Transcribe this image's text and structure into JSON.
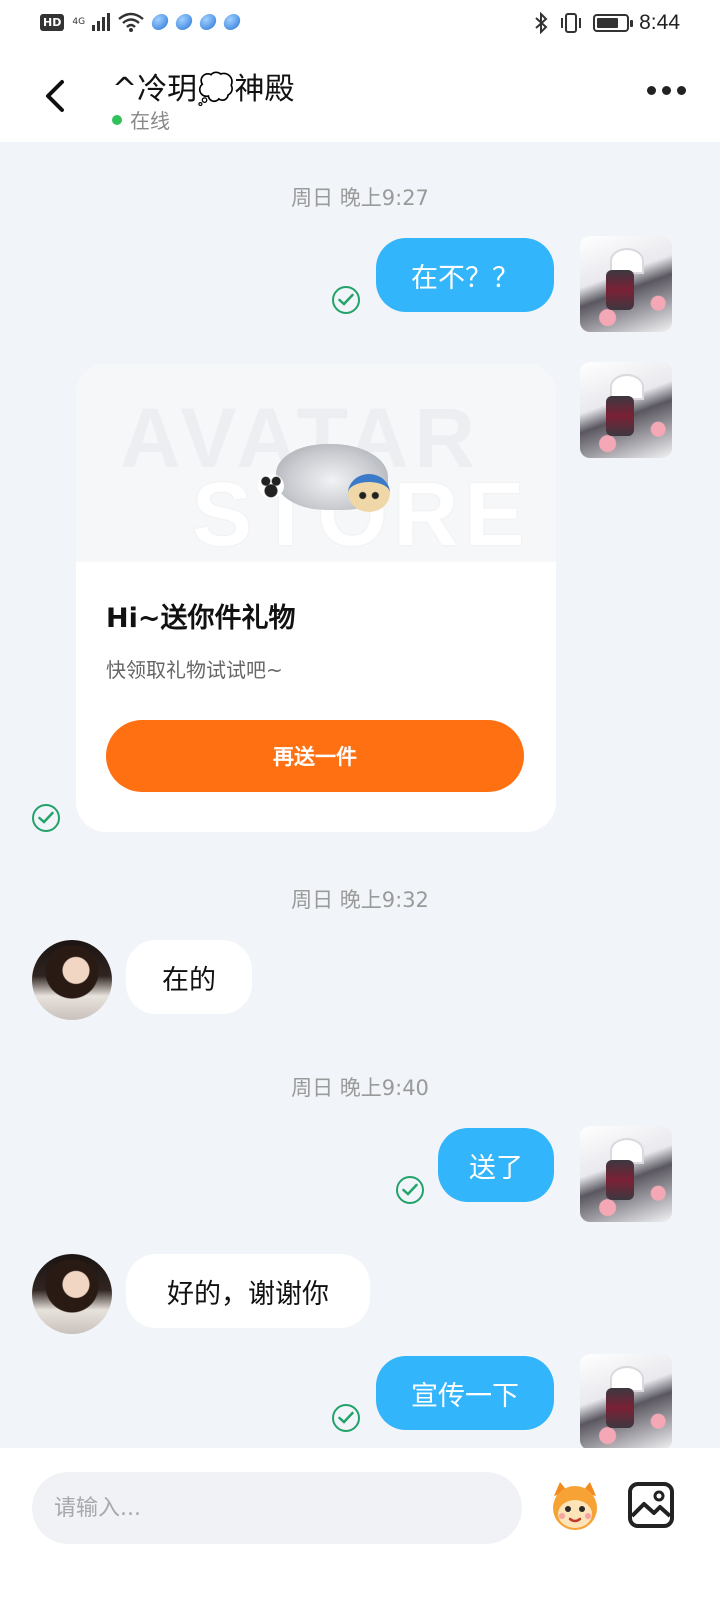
{
  "status_bar": {
    "left_badge": "HD",
    "network": "4G",
    "time": "8:44",
    "battery_level": 0.75,
    "icons": [
      "hd-icon",
      "signal-icon",
      "wifi-icon",
      "app-notification-icon",
      "bluetooth-icon",
      "vibrate-icon",
      "battery-icon"
    ]
  },
  "header": {
    "title": "^冷玥💭神殿",
    "status": "在线",
    "status_color": "#2fc15a",
    "back_icon": "chevron-left-icon",
    "more_icon": "more-dots-icon"
  },
  "messages": [
    {
      "type": "timestamp",
      "text": "周日 晚上9:27"
    },
    {
      "type": "text",
      "side": "out",
      "text": "在不？？",
      "read": true
    },
    {
      "type": "gift_card",
      "side": "out",
      "read": true,
      "watermark_top": "AVATAR",
      "watermark_bottom": "STORE",
      "title": "Hi~送你件礼物",
      "subtitle": "快领取礼物试试吧~",
      "button": "再送一件"
    },
    {
      "type": "timestamp",
      "text": "周日 晚上9:32"
    },
    {
      "type": "text",
      "side": "in",
      "text": "在的"
    },
    {
      "type": "timestamp",
      "text": "周日 晚上9:40"
    },
    {
      "type": "text",
      "side": "out",
      "text": "送了",
      "read": true
    },
    {
      "type": "text",
      "side": "in",
      "text": "好的，谢谢你"
    },
    {
      "type": "text",
      "side": "out",
      "text": "宣传一下",
      "read": true
    }
  ],
  "input_bar": {
    "placeholder": "请输入...",
    "sticker_icon": "sticker-icon",
    "image_icon": "image-icon"
  },
  "colors": {
    "outgoing_bubble": "#33b5fb",
    "incoming_bubble": "#ffffff",
    "read_check": "#22a36a",
    "gift_button": "#fe7011",
    "chat_background": "#f1f4f8"
  }
}
